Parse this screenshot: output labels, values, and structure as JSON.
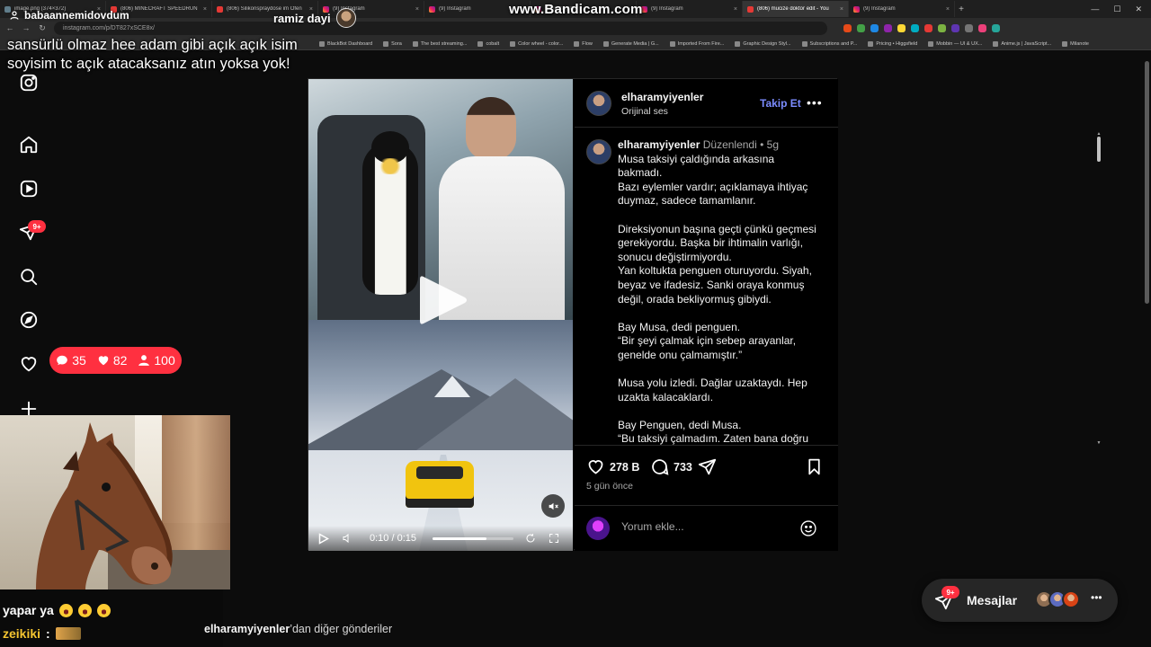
{
  "browser": {
    "tabs": [
      {
        "label": "image.png (374×372)",
        "fav": "img"
      },
      {
        "label": "(806) MINECRAFT SPEEDRUN",
        "fav": "yt"
      },
      {
        "label": "(806) Silikonspraydose im Ofen",
        "fav": "yt"
      },
      {
        "label": "(9) Instagram",
        "fav": "ig"
      },
      {
        "label": "(9) Instagram",
        "fav": "ig"
      },
      {
        "label": "(9) Instagram",
        "fav": "ig"
      },
      {
        "label": "(9) Instagram",
        "fav": "ig"
      },
      {
        "label": "(806) mucize doktor edit - You",
        "fav": "yt",
        "active": true
      },
      {
        "label": "(9) Instagram",
        "fav": "ig"
      }
    ],
    "url": "instagram.com/p/DT827xSCE8x/",
    "bookmarks": [
      "BlackBot Dashboard",
      "Sora",
      "The best streaming...",
      "cobalt",
      "Color wheel - color...",
      "Flow",
      "Generate Media | G...",
      "Imported From Fire...",
      "Graphic Design Styl...",
      "Subscriptions and P...",
      "Pricing • Higgsfield",
      "Mobbin — UI & UX...",
      "Anime.js | JavaScript...",
      "Milanote"
    ]
  },
  "watermark": "www.Bandicam.com",
  "stream": {
    "streamer": "babaannemidovdum",
    "guest": "ramiz dayi",
    "overlay_message": "sansürlü olmaz hee adam gibi açık açık isim soyisim tc açık atacaksanız atın yoksa yok!",
    "stats": {
      "comments": "35",
      "likes": "82",
      "viewers": "100"
    },
    "chat": [
      {
        "text": "yapar ya"
      },
      {
        "user": "zeikiki",
        "sep": ":"
      }
    ]
  },
  "sidebar": {
    "items": [
      "instagram-logo",
      "home",
      "reels",
      "direct",
      "search",
      "explore",
      "notifications",
      "create"
    ],
    "direct_badge": "9+"
  },
  "post": {
    "username": "elharamyiyenler",
    "audio": "Orijinal ses",
    "follow_label": "Takip Et",
    "more_label": "•••",
    "caption_meta_edited": "Düzenlendi",
    "caption_meta_sep": "•",
    "caption_age": "5g",
    "caption_paragraphs": [
      "Musa taksiyi çaldığında arkasına bakmadı.\nBazı eylemler vardır; açıklamaya ihtiyaç duymaz, sadece tamamlanır.",
      "Direksiyonun başına geçti çünkü geçmesi gerekiyordu. Başka bir ihtimalin varlığı, sonucu değiştirmiyordu.\nYan koltukta penguen oturuyordu. Siyah, beyaz ve ifadesiz. Sanki oraya konmuş değil, orada bekliyormuş gibiydi.",
      "Bay Musa, dedi penguen.\n“Bir şeyi çalmak için sebep arayanlar, genelde onu çalmamıştır.”",
      "Musa yolu izledi. Dağlar uzaktaydı. Hep uzakta kalacaklardı.",
      "Bay Penguen, dedi Musa.\n“Bu taksiyi çalmadım. Zaten bana doğru gelmişti.”"
    ],
    "likes": "278 B",
    "comments": "733",
    "date": "5 gün önce",
    "comment_placeholder": "Yorum ekle...",
    "video": {
      "time": "0:10 / 0:15",
      "progress": 0.667
    }
  },
  "more_posts": {
    "user": "elharamyiyenler",
    "suffix": "’dan diğer gönderiler"
  },
  "messages": {
    "label": "Mesajlar",
    "badge": "9+",
    "more": "•••",
    "avatar_colors": [
      "#8e6e53",
      "#5c6bc0",
      "#d84315"
    ]
  },
  "colors": {
    "accent": "#ff3040",
    "link": "#7b8cff",
    "bg": "#000000"
  }
}
